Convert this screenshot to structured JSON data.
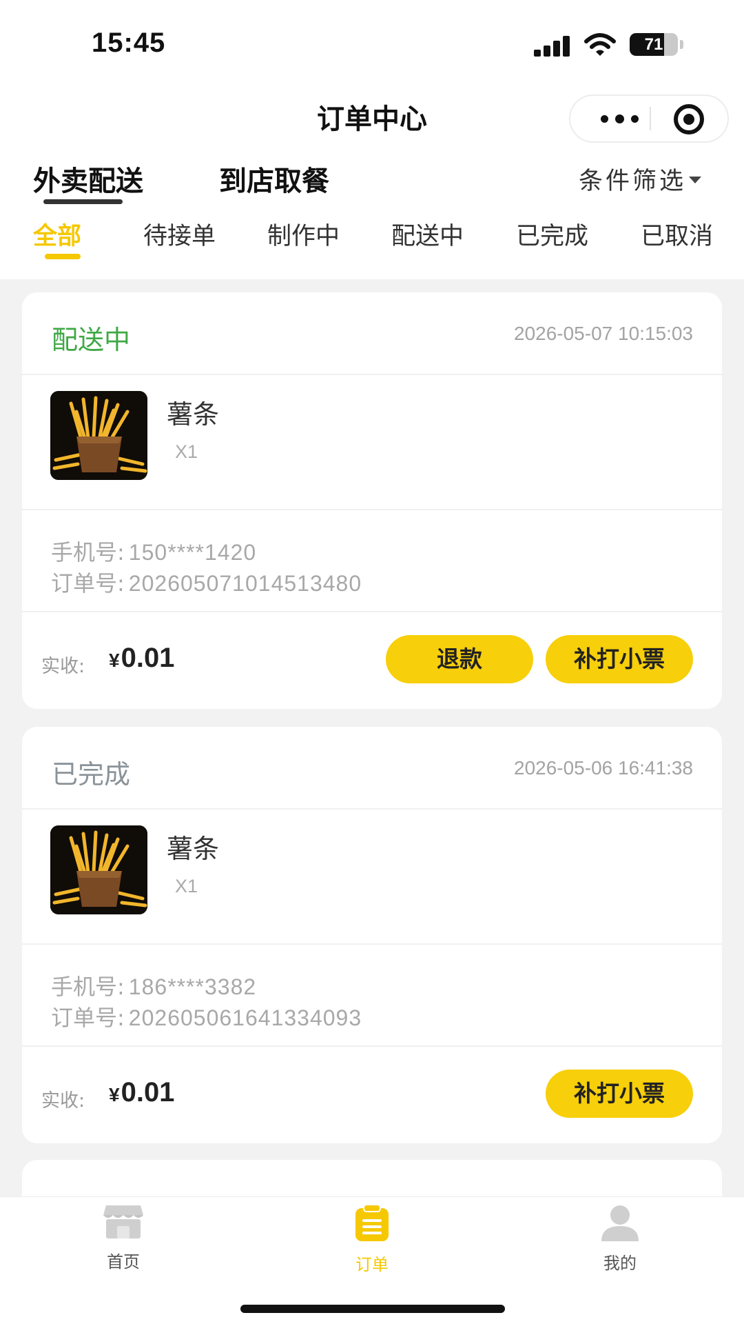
{
  "status_bar": {
    "time": "15:45",
    "battery": "71",
    "battery_level": 0.71
  },
  "nav": {
    "title": "订单中心"
  },
  "mode_tabs": [
    {
      "label": "外卖配送",
      "active": true
    },
    {
      "label": "到店取餐",
      "active": false
    }
  ],
  "filter": {
    "label": "条件筛选"
  },
  "status_tabs": [
    {
      "label": "全部",
      "active": true
    },
    {
      "label": "待接单",
      "active": false
    },
    {
      "label": "制作中",
      "active": false
    },
    {
      "label": "配送中",
      "active": false
    },
    {
      "label": "已完成",
      "active": false
    },
    {
      "label": "已取消",
      "active": false
    }
  ],
  "orders": [
    {
      "status": "配送中",
      "status_color": "#3fa845",
      "time": "2026-05-07 10:15:03",
      "item_name": "薯条",
      "item_qty": "X1",
      "phone_label": "手机号:",
      "phone": "150****1420",
      "order_no_label": "订单号:",
      "order_no": "202605071014513480",
      "paid_label": "实收:",
      "currency": "¥",
      "amount": "0.01",
      "refund_label": "退款",
      "reprint_label": "补打小票"
    },
    {
      "status": "已完成",
      "status_color": "#8a9399",
      "time": "2026-05-06 16:41:38",
      "item_name": "薯条",
      "item_qty": "X1",
      "phone_label": "手机号:",
      "phone": "186****3382",
      "order_no_label": "订单号:",
      "order_no": "202605061641334093",
      "paid_label": "实收:",
      "currency": "¥",
      "amount": "0.01",
      "reprint_label": "补打小票"
    }
  ],
  "tabbar": [
    {
      "label": "首页",
      "icon": "store-icon",
      "active": false
    },
    {
      "label": "订单",
      "icon": "order-list-icon",
      "active": true
    },
    {
      "label": "我的",
      "icon": "user-icon",
      "active": false
    }
  ],
  "colors": {
    "accent": "#f7cf0a",
    "active_tab": "#f5c800",
    "background": "#f2f2f2"
  }
}
